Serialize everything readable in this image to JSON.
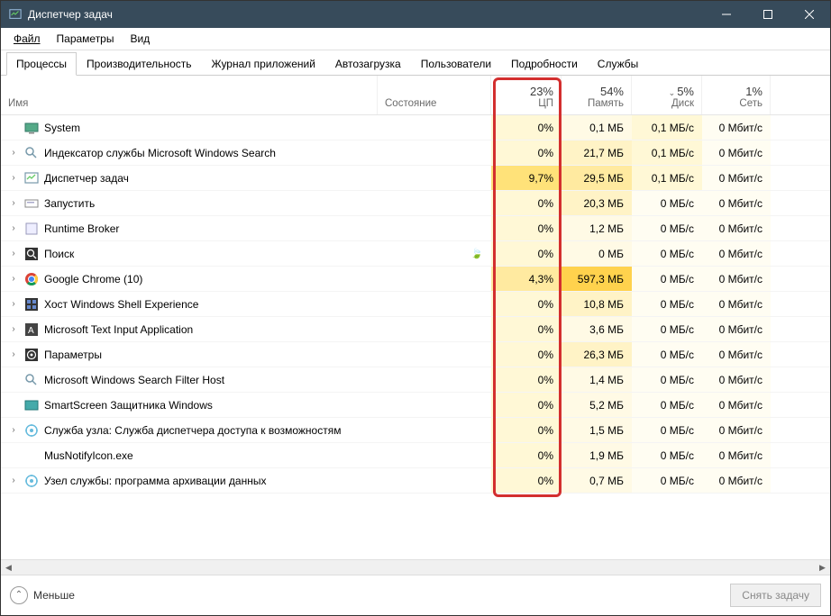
{
  "window": {
    "title": "Диспетчер задач"
  },
  "menu": {
    "file": "Файл",
    "options": "Параметры",
    "view": "Вид"
  },
  "tabs": [
    {
      "label": "Процессы",
      "active": true
    },
    {
      "label": "Производительность",
      "active": false
    },
    {
      "label": "Журнал приложений",
      "active": false
    },
    {
      "label": "Автозагрузка",
      "active": false
    },
    {
      "label": "Пользователи",
      "active": false
    },
    {
      "label": "Подробности",
      "active": false
    },
    {
      "label": "Службы",
      "active": false
    }
  ],
  "columns": {
    "name": "Имя",
    "status": "Состояние",
    "cpu": {
      "pct": "23%",
      "label": "ЦП"
    },
    "memory": {
      "pct": "54%",
      "label": "Память"
    },
    "disk": {
      "caret": "⌄",
      "pct": "5%",
      "label": "Диск"
    },
    "network": {
      "pct": "1%",
      "label": "Сеть"
    }
  },
  "processes": [
    {
      "expand": false,
      "icon": "system",
      "name": "System",
      "suspended": false,
      "cpu": "0%",
      "cpu_heat": "0",
      "mem": "0,1 МБ",
      "mem_heat": "0",
      "disk": "0,1 МБ/с",
      "disk_heat": "low",
      "net": "0 Мбит/с"
    },
    {
      "expand": true,
      "icon": "search",
      "name": "Индексатор службы Microsoft Windows Search",
      "suspended": false,
      "cpu": "0%",
      "cpu_heat": "0",
      "mem": "21,7 МБ",
      "mem_heat": "low",
      "disk": "0,1 МБ/с",
      "disk_heat": "low",
      "net": "0 Мбит/с"
    },
    {
      "expand": true,
      "icon": "taskmgr",
      "name": "Диспетчер задач",
      "suspended": false,
      "cpu": "9,7%",
      "cpu_heat": "10",
      "mem": "29,5 МБ",
      "mem_heat": "med",
      "disk": "0,1 МБ/с",
      "disk_heat": "low",
      "net": "0 Мбит/с"
    },
    {
      "expand": true,
      "icon": "run",
      "name": "Запустить",
      "suspended": false,
      "cpu": "0%",
      "cpu_heat": "0",
      "mem": "20,3 МБ",
      "mem_heat": "low",
      "disk": "0 МБ/с",
      "disk_heat": "0",
      "net": "0 Мбит/с"
    },
    {
      "expand": true,
      "icon": "runtime",
      "name": "Runtime Broker",
      "suspended": false,
      "cpu": "0%",
      "cpu_heat": "0",
      "mem": "1,2 МБ",
      "mem_heat": "0",
      "disk": "0 МБ/с",
      "disk_heat": "0",
      "net": "0 Мбит/с"
    },
    {
      "expand": true,
      "icon": "search2",
      "name": "Поиск",
      "suspended": true,
      "cpu": "0%",
      "cpu_heat": "0",
      "mem": "0 МБ",
      "mem_heat": "0",
      "disk": "0 МБ/с",
      "disk_heat": "0",
      "net": "0 Мбит/с"
    },
    {
      "expand": true,
      "icon": "chrome",
      "name": "Google Chrome (10)",
      "suspended": false,
      "cpu": "4,3%",
      "cpu_heat": "4",
      "mem": "597,3 МБ",
      "mem_heat": "high",
      "disk": "0 МБ/с",
      "disk_heat": "0",
      "net": "0 Мбит/с"
    },
    {
      "expand": true,
      "icon": "shell",
      "name": "Хост Windows Shell Experience",
      "suspended": false,
      "cpu": "0%",
      "cpu_heat": "0",
      "mem": "10,8 МБ",
      "mem_heat": "low",
      "disk": "0 МБ/с",
      "disk_heat": "0",
      "net": "0 Мбит/с"
    },
    {
      "expand": true,
      "icon": "textinput",
      "name": "Microsoft Text Input Application",
      "suspended": false,
      "cpu": "0%",
      "cpu_heat": "0",
      "mem": "3,6 МБ",
      "mem_heat": "0",
      "disk": "0 МБ/с",
      "disk_heat": "0",
      "net": "0 Мбит/с"
    },
    {
      "expand": true,
      "icon": "settings",
      "name": "Параметры",
      "suspended": false,
      "cpu": "0%",
      "cpu_heat": "0",
      "mem": "26,3 МБ",
      "mem_heat": "low",
      "disk": "0 МБ/с",
      "disk_heat": "0",
      "net": "0 Мбит/с"
    },
    {
      "expand": false,
      "icon": "search",
      "name": "Microsoft Windows Search Filter Host",
      "suspended": false,
      "cpu": "0%",
      "cpu_heat": "0",
      "mem": "1,4 МБ",
      "mem_heat": "0",
      "disk": "0 МБ/с",
      "disk_heat": "0",
      "net": "0 Мбит/с"
    },
    {
      "expand": false,
      "icon": "smartscreen",
      "name": "SmartScreen Защитника Windows",
      "suspended": false,
      "cpu": "0%",
      "cpu_heat": "0",
      "mem": "5,2 МБ",
      "mem_heat": "0",
      "disk": "0 МБ/с",
      "disk_heat": "0",
      "net": "0 Мбит/с"
    },
    {
      "expand": true,
      "icon": "service",
      "name": "Служба узла: Служба диспетчера доступа к возможностям",
      "suspended": false,
      "cpu": "0%",
      "cpu_heat": "0",
      "mem": "1,5 МБ",
      "mem_heat": "0",
      "disk": "0 МБ/с",
      "disk_heat": "0",
      "net": "0 Мбит/с"
    },
    {
      "expand": false,
      "icon": "blank",
      "name": "MusNotifyIcon.exe",
      "suspended": false,
      "cpu": "0%",
      "cpu_heat": "0",
      "mem": "1,9 МБ",
      "mem_heat": "0",
      "disk": "0 МБ/с",
      "disk_heat": "0",
      "net": "0 Мбит/с"
    },
    {
      "expand": true,
      "icon": "service",
      "name": "Узел службы: программа архивации данных",
      "suspended": false,
      "cpu": "0%",
      "cpu_heat": "0",
      "mem": "0,7 МБ",
      "mem_heat": "0",
      "disk": "0 МБ/с",
      "disk_heat": "0",
      "net": "0 Мбит/с"
    }
  ],
  "footer": {
    "fewer": "Меньше",
    "end_task": "Снять задачу"
  }
}
